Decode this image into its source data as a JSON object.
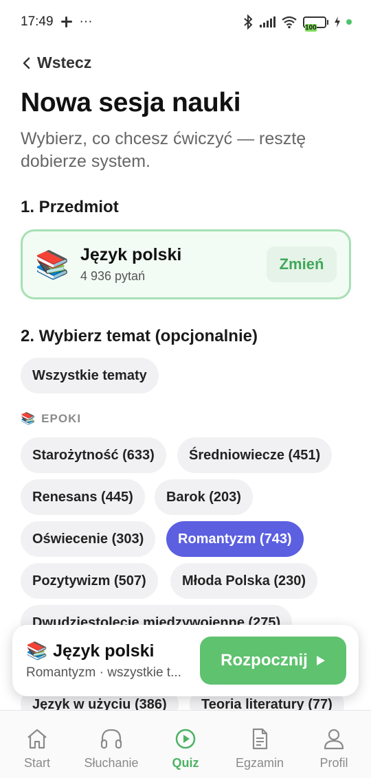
{
  "status": {
    "time": "17:49",
    "battery": "100",
    "dots": "···"
  },
  "nav": {
    "back_label": "Wstecz"
  },
  "header": {
    "title": "Nowa sesja nauki",
    "subtitle": "Wybierz, co chcesz ćwiczyć — resztę dobierze system."
  },
  "section1": {
    "heading": "1. Przedmiot",
    "subject_icon": "📚",
    "subject_name": "Język polski",
    "subject_count": "4 936 pytań",
    "change_label": "Zmień"
  },
  "section2": {
    "heading": "2. Wybierz temat (opcjonalnie)",
    "all_topics": "Wszystkie tematy",
    "group_icon": "📚",
    "group_label": "EPOKI",
    "topics": [
      "Starożytność (633)",
      "Średniowiecze (451)",
      "Renesans (445)",
      "Barok (203)",
      "Oświecenie (303)",
      "Romantyzm (743)",
      "Pozytywizm (507)",
      "Młoda Polska (230)",
      "Dwudziestolecie międzywojenne (275)",
      "Język w użyciu (386)",
      "Teoria literatury (77)"
    ],
    "selected_topic": "Romantyzm (743)"
  },
  "floating": {
    "icon": "📚",
    "title": "Język polski",
    "subtitle": "Romantyzm · wszystkie t...",
    "start_label": "Rozpocznij"
  },
  "tabs": [
    {
      "label": "Start",
      "icon": "home-icon"
    },
    {
      "label": "Słuchanie",
      "icon": "headphones-icon"
    },
    {
      "label": "Quiz",
      "icon": "play-circle-icon"
    },
    {
      "label": "Egzamin",
      "icon": "document-icon"
    },
    {
      "label": "Profil",
      "icon": "person-icon"
    }
  ],
  "colors": {
    "accent_green": "#5ec26e",
    "selected_chip": "#5b5fe0",
    "card_border": "#a7e0b4"
  }
}
